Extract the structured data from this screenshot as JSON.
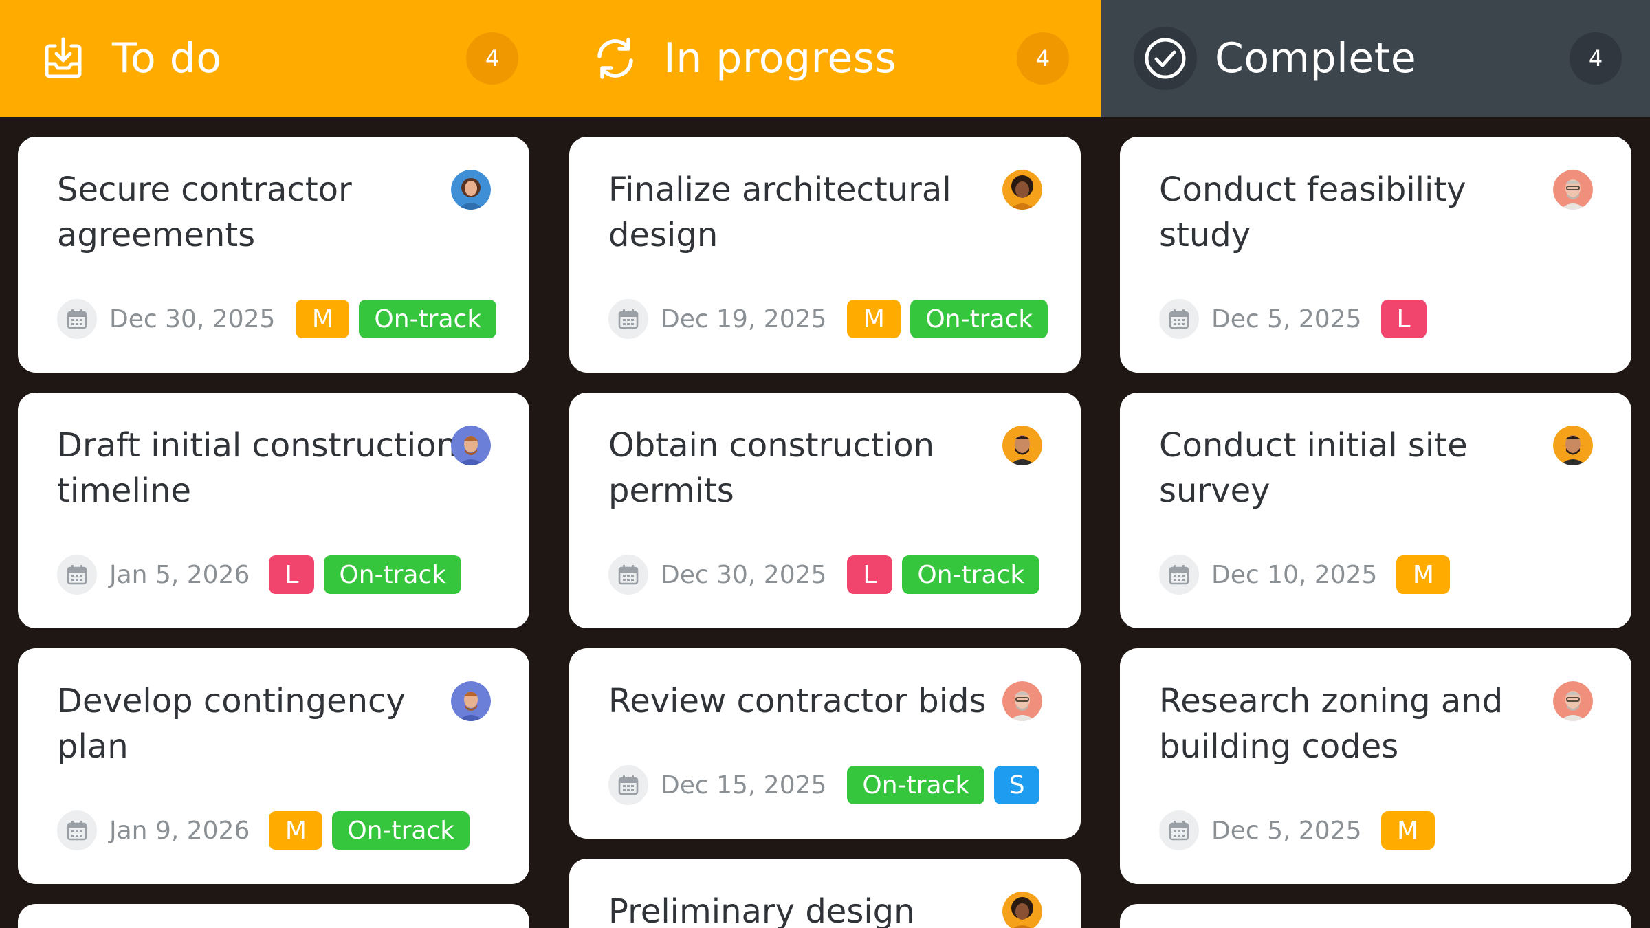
{
  "columns": [
    {
      "title": "To do",
      "count": "4",
      "icon": "inbox-download-icon",
      "header_color": "#ffab00",
      "cards": [
        {
          "title": "Secure contractor agreements",
          "date": "Dec 30, 2025",
          "size": "M",
          "status": "On-track"
        },
        {
          "title": "Draft initial construction timeline",
          "date": "Jan 5, 2026",
          "size": "L",
          "status": "On-track"
        },
        {
          "title": "Develop contingency plan",
          "date": "Jan 9, 2026",
          "size": "M",
          "status": "On-track"
        }
      ]
    },
    {
      "title": "In progress",
      "count": "4",
      "icon": "refresh-icon",
      "header_color": "#ffab00",
      "cards": [
        {
          "title": "Finalize architectural design",
          "date": "Dec 19, 2025",
          "size": "M",
          "status": "On-track"
        },
        {
          "title": "Obtain construction permits",
          "date": "Dec 30, 2025",
          "size": "L",
          "status": "On-track"
        },
        {
          "title": "Review contractor bids",
          "date": "Dec 15, 2025",
          "status": "On-track",
          "size": "S"
        },
        {
          "title": "Preliminary design"
        }
      ]
    },
    {
      "title": "Complete",
      "count": "4",
      "icon": "check-circle-icon",
      "header_color": "#3c444c",
      "cards": [
        {
          "title": "Conduct feasibility study",
          "date": "Dec 5, 2025",
          "size": "L"
        },
        {
          "title": "Conduct initial site survey",
          "date": "Dec 10, 2025",
          "size": "M"
        },
        {
          "title": "Research zoning and building codes",
          "date": "Dec 5, 2025",
          "size": "M"
        }
      ]
    }
  ],
  "colors": {
    "background": "#1f1714",
    "size_m": "#ffab00",
    "size_l": "#f2456d",
    "size_s": "#1e9cf0",
    "on_track": "#35c63d"
  }
}
